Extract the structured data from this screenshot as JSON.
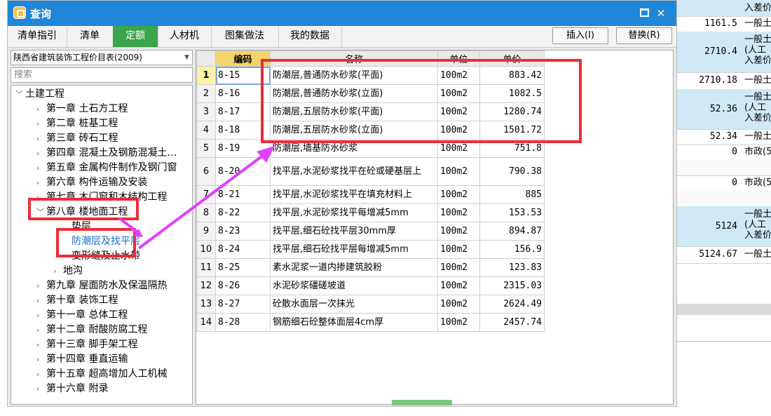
{
  "background": {
    "rows": [
      {
        "num": "",
        "type": "入差价"
      },
      {
        "num": "1161.5",
        "type": "一般土"
      },
      {
        "num": "2710.4",
        "type": "一般土\n(人工\n入差价"
      },
      {
        "num": "2710.18",
        "type": "一般土"
      },
      {
        "num": "52.36",
        "type": "一般土\n(人工\n入差价"
      },
      {
        "num": "52.34",
        "type": "一般土"
      },
      {
        "num": "0",
        "type": "市政(5"
      },
      {
        "num": "0",
        "type": "市政(5"
      },
      {
        "num": "5124",
        "type": "一般土\n(人工\n入差价"
      },
      {
        "num": "5124.67",
        "type": "一般土"
      }
    ]
  },
  "dialog": {
    "title": "查询",
    "tabs": [
      "清单指引",
      "清单",
      "定额",
      "人材机",
      "图集做法",
      "我的数据"
    ],
    "active_tab": 2,
    "insert_label": "插入(I)",
    "replace_label": "替换(R)"
  },
  "library": {
    "selected": "陕西省建筑装饰工程价目表(2009)",
    "search_placeholder": "搜索"
  },
  "tree": {
    "root": "土建工程",
    "chapters": [
      "第一章 土石方工程",
      "第二章 桩基工程",
      "第三章 砖石工程",
      "第四章 混凝土及钢筋混凝土…",
      "第五章 金属构件制作及钢门窗",
      "第六章 构件运输及安装",
      "第七章 木门窗和木结构工程",
      "第八章 楼地面工程"
    ],
    "chapter8_children": [
      "垫层",
      "防潮层及找平层",
      "变形缝及止水带",
      "地沟"
    ],
    "chapters_after": [
      "第九章 屋面防水及保温隔热",
      "第十章 装饰工程",
      "第十一章 总体工程",
      "第十二章 耐酸防腐工程",
      "第十三章 脚手架工程",
      "第十四章 垂直运输",
      "第十五章 超高增加人工机械",
      "第十六章 附录"
    ]
  },
  "grid": {
    "headers": {
      "code": "编码",
      "name": "名称",
      "unit": "单位",
      "price": "单价"
    },
    "rows": [
      {
        "n": "1",
        "code": "8-15",
        "name": "防潮层,普通防水砂浆(平面)",
        "unit": "100m2",
        "price": "883.42"
      },
      {
        "n": "2",
        "code": "8-16",
        "name": "防潮层,普通防水砂浆(立面)",
        "unit": "100m2",
        "price": "1082.5"
      },
      {
        "n": "3",
        "code": "8-17",
        "name": "防潮层,五层防水砂浆(平面)",
        "unit": "100m2",
        "price": "1280.74"
      },
      {
        "n": "4",
        "code": "8-18",
        "name": "防潮层,五层防水砂浆(立面)",
        "unit": "100m2",
        "price": "1501.72"
      },
      {
        "n": "5",
        "code": "8-19",
        "name": "防潮层,墙基防水砂浆",
        "unit": "100m2",
        "price": "751.8"
      },
      {
        "n": "6",
        "code": "8-20",
        "name": "找平层,水泥砂浆找平在砼或硬基层上",
        "unit": "100m2",
        "price": "790.38"
      },
      {
        "n": "7",
        "code": "8-21",
        "name": "找平层,水泥砂浆找平在填充材料上",
        "unit": "100m2",
        "price": "885"
      },
      {
        "n": "8",
        "code": "8-22",
        "name": "找平层,水泥砂浆找平每增减5mm",
        "unit": "100m2",
        "price": "153.53"
      },
      {
        "n": "9",
        "code": "8-23",
        "name": "找平层,细石砼找平层30mm厚",
        "unit": "100m2",
        "price": "894.87"
      },
      {
        "n": "10",
        "code": "8-24",
        "name": "找平层,细石砼找平层每增减5mm",
        "unit": "100m2",
        "price": "156.9"
      },
      {
        "n": "11",
        "code": "8-25",
        "name": "素水泥浆一道内掺建筑胶粉",
        "unit": "100m2",
        "price": "123.83"
      },
      {
        "n": "12",
        "code": "8-26",
        "name": "水泥砂浆礓磋坡道",
        "unit": "100m2",
        "price": "2315.03"
      },
      {
        "n": "13",
        "code": "8-27",
        "name": "砼散水面层一次抹光",
        "unit": "100m2",
        "price": "2624.49"
      },
      {
        "n": "14",
        "code": "8-28",
        "name": "钢筋细石砼整体面层4cm厚",
        "unit": "100m2",
        "price": "2457.74"
      }
    ]
  },
  "colors": {
    "titlebar": "#1f86d8",
    "active_tab": "#3aa54a",
    "annotation_red": "#ef2b3a",
    "arrow_magenta": "#e040fb",
    "selected_text": "#1a6fd1"
  }
}
